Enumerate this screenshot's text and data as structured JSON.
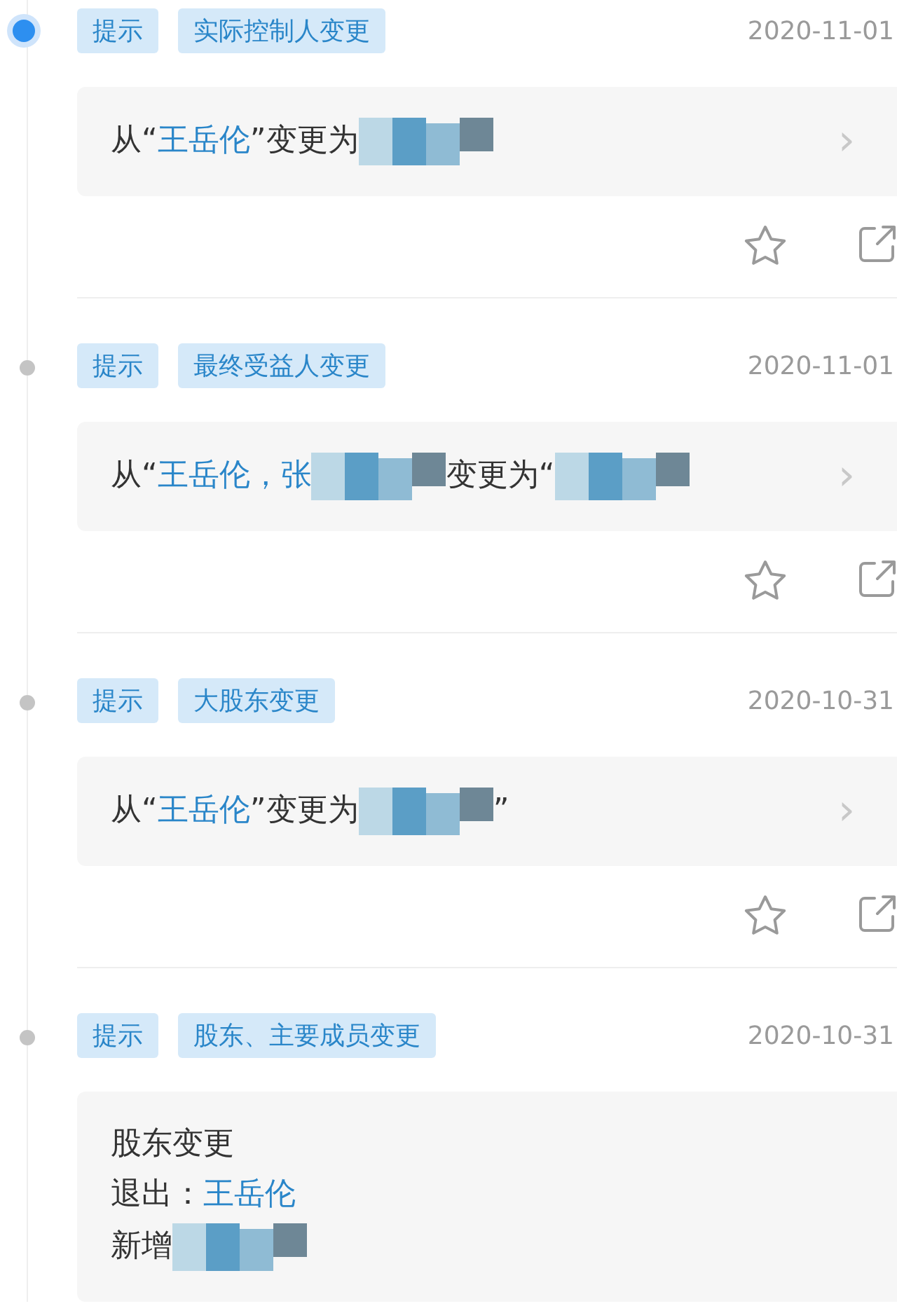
{
  "events": [
    {
      "latest": true,
      "tags": [
        "提示",
        "实际控制人变更"
      ],
      "date": "2020-11-01",
      "lines": [
        [
          {
            "kind": "text",
            "text": "从“"
          },
          {
            "kind": "link",
            "text": "王岳伦"
          },
          {
            "kind": "text",
            "text": "”变更为"
          },
          {
            "kind": "redacted"
          }
        ]
      ],
      "chevron": "›"
    },
    {
      "latest": false,
      "tags": [
        "提示",
        "最终受益人变更"
      ],
      "date": "2020-11-01",
      "lines": [
        [
          {
            "kind": "text",
            "text": "从“"
          },
          {
            "kind": "link",
            "text": "王岳伦，"
          },
          {
            "kind": "link",
            "text": "张"
          },
          {
            "kind": "redacted"
          },
          {
            "kind": "text",
            "text": "变更为“"
          },
          {
            "kind": "redacted"
          }
        ]
      ],
      "chevron": "›"
    },
    {
      "latest": false,
      "tags": [
        "提示",
        "大股东变更"
      ],
      "date": "2020-10-31",
      "lines": [
        [
          {
            "kind": "text",
            "text": "从“"
          },
          {
            "kind": "link",
            "text": "王岳伦"
          },
          {
            "kind": "text",
            "text": "”变更为"
          },
          {
            "kind": "redacted"
          },
          {
            "kind": "text",
            "text": "”"
          }
        ]
      ],
      "chevron": "›"
    },
    {
      "latest": false,
      "tags": [
        "提示",
        "股东、主要成员变更"
      ],
      "date": "2020-10-31",
      "lines": [
        [
          {
            "kind": "text",
            "text": "股东变更"
          }
        ],
        [
          {
            "kind": "text",
            "text": "退出："
          },
          {
            "kind": "link",
            "text": "王岳伦"
          }
        ],
        [
          {
            "kind": "text",
            "text": "新增"
          },
          {
            "kind": "redacted"
          }
        ]
      ]
    }
  ]
}
